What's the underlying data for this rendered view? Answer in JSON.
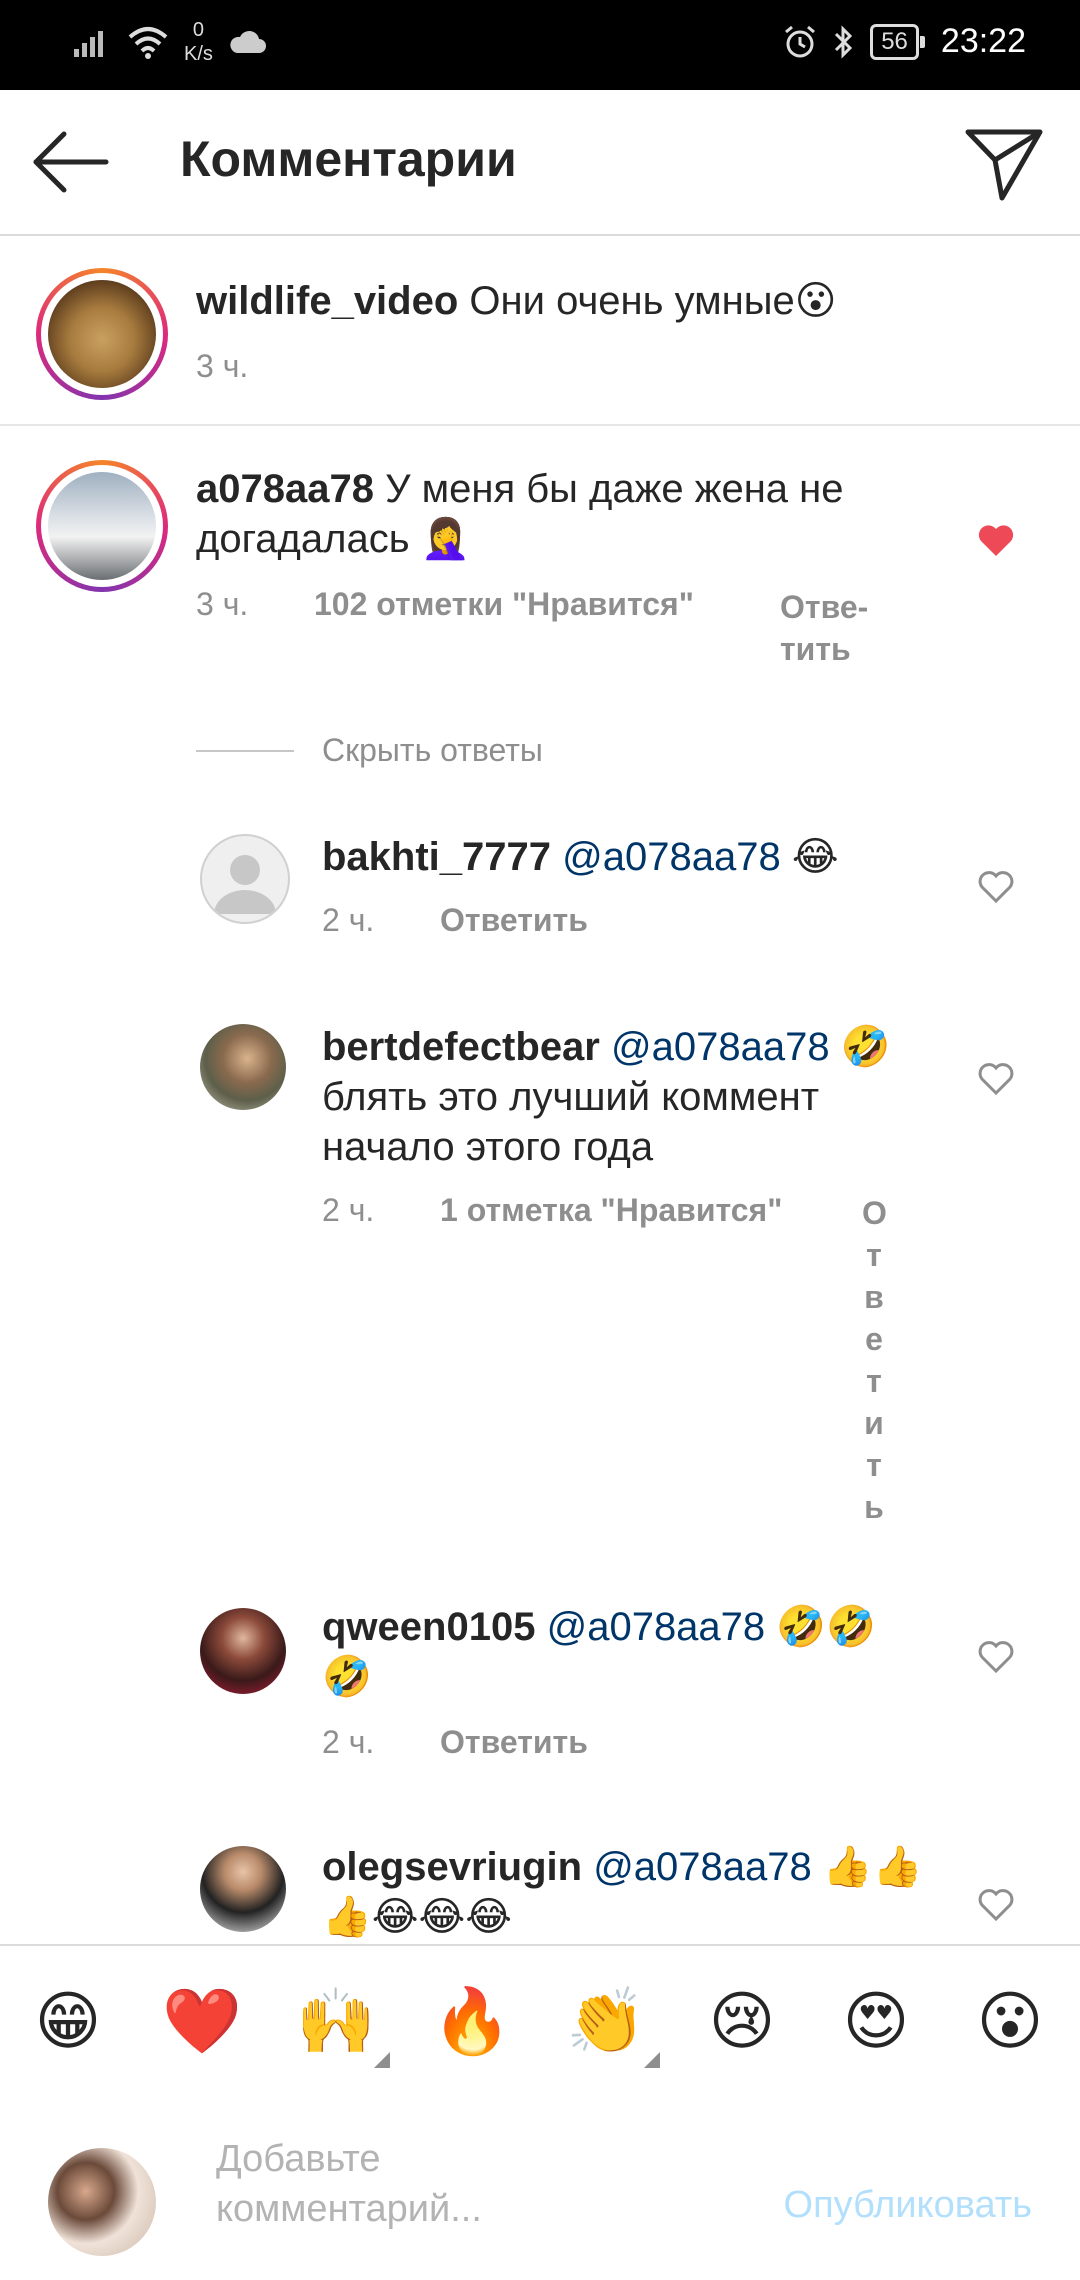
{
  "status_bar": {
    "net_speed_value": "0",
    "net_speed_unit": "K/s",
    "battery": "56",
    "time": "23:22"
  },
  "header": {
    "title": "Комментарии"
  },
  "caption": {
    "username": "wildlife_video",
    "text": "Они очень умные😮",
    "time": "3 ч."
  },
  "comment": {
    "username": "a078aa78",
    "text": "У меня бы даже  жена не догадалась 🤦‍♀️",
    "time": "3 ч.",
    "likes": "102 отметки \"Нравится\"",
    "reply_label": "Отве-тить",
    "liked": true
  },
  "hide_replies_label": "Скрыть ответы",
  "replies": [
    {
      "username": "bakhti_7777",
      "mention": "@a078aa78",
      "text": " 😂",
      "time": "2 ч.",
      "likes": "",
      "reply_label": "Ответить"
    },
    {
      "username": "bertdefectbear",
      "mention": "@a078aa78",
      "text": " 🤣 блять это лучший коммент начало этого года",
      "time": "2 ч.",
      "likes": "1 отметка \"Нравится\"",
      "reply_label": "Ответить"
    },
    {
      "username": "qween0105",
      "mention": "@a078aa78",
      "text": " 🤣🤣🤣",
      "time": "2 ч.",
      "likes": "",
      "reply_label": "Ответить"
    },
    {
      "username": "olegsevriugin",
      "mention": "@a078aa78",
      "text": " 👍👍👍😂😂😂",
      "time": "",
      "likes": "",
      "reply_label": ""
    }
  ],
  "emoji_bar": [
    "😁",
    "❤️",
    "🙌",
    "🔥",
    "👏",
    "😢",
    "😍",
    "😮"
  ],
  "composer": {
    "placeholder": "Добавьте комментарий...",
    "publish_label": "Опубликовать"
  },
  "colors": {
    "like_red": "#ed4956",
    "mention_blue": "#003569",
    "publish_disabled": "#b2dffc"
  }
}
